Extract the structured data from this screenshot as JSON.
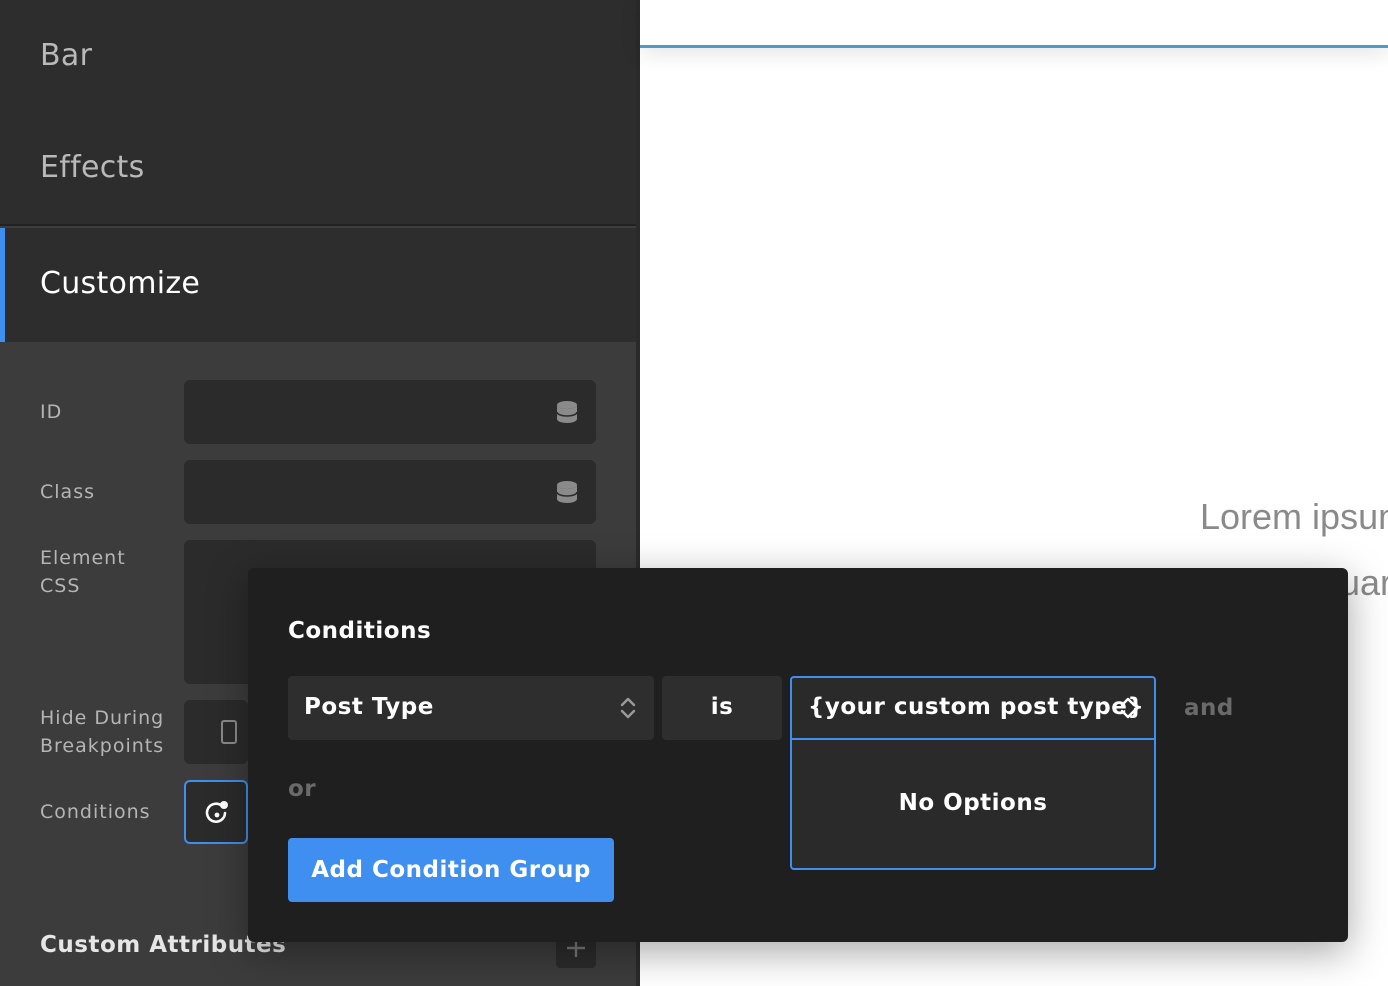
{
  "sidebar": {
    "sections": {
      "bar": "Bar",
      "effects": "Effects",
      "customize": "Customize"
    },
    "fields": {
      "id_label": "ID",
      "class_label": "Class",
      "element_css_label_line1": "Element",
      "element_css_label_line2": "CSS",
      "hide_breakpoints_line1": "Hide During",
      "hide_breakpoints_line2": "Breakpoints",
      "conditions_label": "Conditions"
    },
    "custom_attributes": "Custom Attributes"
  },
  "preview": {
    "lorem_line1": "Lorem ipsum",
    "lorem_line2": "uar"
  },
  "conditions_popup": {
    "title": "Conditions",
    "type_select": "Post Type",
    "operator": "is",
    "value_input": "{your custom post type}",
    "dropdown_message": "No Options",
    "and_label": "and",
    "or_label": "or",
    "add_group_button": "Add Condition Group"
  },
  "colors": {
    "accent": "#3f8ff0",
    "sidebar_bg": "#3c3c3c",
    "section_bg": "#2d2d2d",
    "popup_bg": "#1f1f1f",
    "preview_topbar_border": "#4f9cc2"
  },
  "icons": {
    "id_field": "database-icon",
    "class_field": "database-icon",
    "breakpoint": "mobile-device-icon",
    "conditions": "conditions-icon",
    "add_attribute": "plus-icon",
    "select": "chevron-up-down-icon"
  }
}
